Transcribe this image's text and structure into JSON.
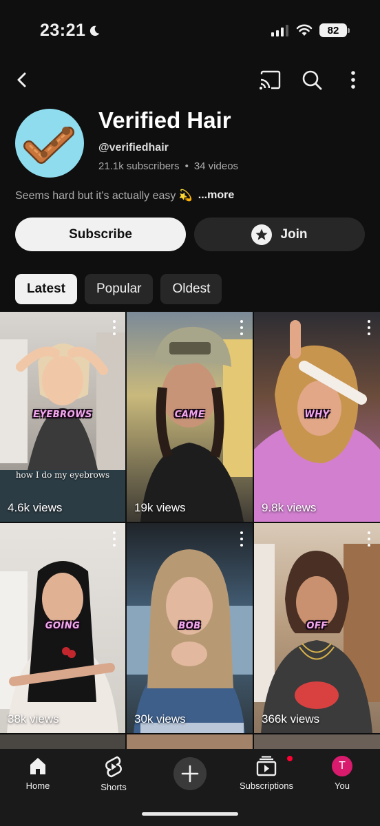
{
  "status_bar": {
    "time": "23:21",
    "battery": "82"
  },
  "header": {
    "back_icon": "chevron-left-icon",
    "cast_icon": "cast-icon",
    "search_icon": "search-icon",
    "more_icon": "more-vertical-icon"
  },
  "channel": {
    "name": "Verified Hair",
    "handle": "@verifiedhair",
    "subscribers": "21.1k subscribers",
    "separator": "•",
    "videos": "34 videos",
    "description": "Seems hard but it's actually easy 💫",
    "more_label": "...more",
    "avatar_bg": "#8fdcef"
  },
  "buttons": {
    "subscribe": "Subscribe",
    "join": "Join"
  },
  "chips": [
    {
      "label": "Latest",
      "active": true
    },
    {
      "label": "Popular",
      "active": false
    },
    {
      "label": "Oldest",
      "active": false
    }
  ],
  "videos": [
    {
      "caption": "EYEBROWS",
      "views": "4.6k views",
      "overlay": "how I do my eyebrows",
      "bg": "#b9b4ad"
    },
    {
      "caption": "CAME",
      "views": "19k views",
      "overlay": "",
      "bg": "#6e6b5a"
    },
    {
      "caption": "WHY",
      "views": "9.8k views",
      "overlay": "",
      "bg": "#c69a6e"
    },
    {
      "caption": "GOING",
      "views": "38k views",
      "overlay": "",
      "bg": "#d8d4cf"
    },
    {
      "caption": "BOB",
      "views": "30k views",
      "overlay": "",
      "bg": "#6d7f8c"
    },
    {
      "caption": "OFF",
      "views": "366k views",
      "overlay": "",
      "bg": "#c9b8a6"
    }
  ],
  "bottom_nav": [
    {
      "label": "Home",
      "icon": "home-icon"
    },
    {
      "label": "Shorts",
      "icon": "shorts-icon"
    },
    {
      "label": "",
      "icon": "add-icon"
    },
    {
      "label": "Subscriptions",
      "icon": "subscriptions-icon"
    },
    {
      "label": "You",
      "icon": "avatar",
      "initial": "T",
      "avatar_bg": "#d81b6c"
    }
  ],
  "colors": {
    "background": "#0f0f0f",
    "chip_bg": "#272727",
    "accent_red": "#ff0033"
  }
}
